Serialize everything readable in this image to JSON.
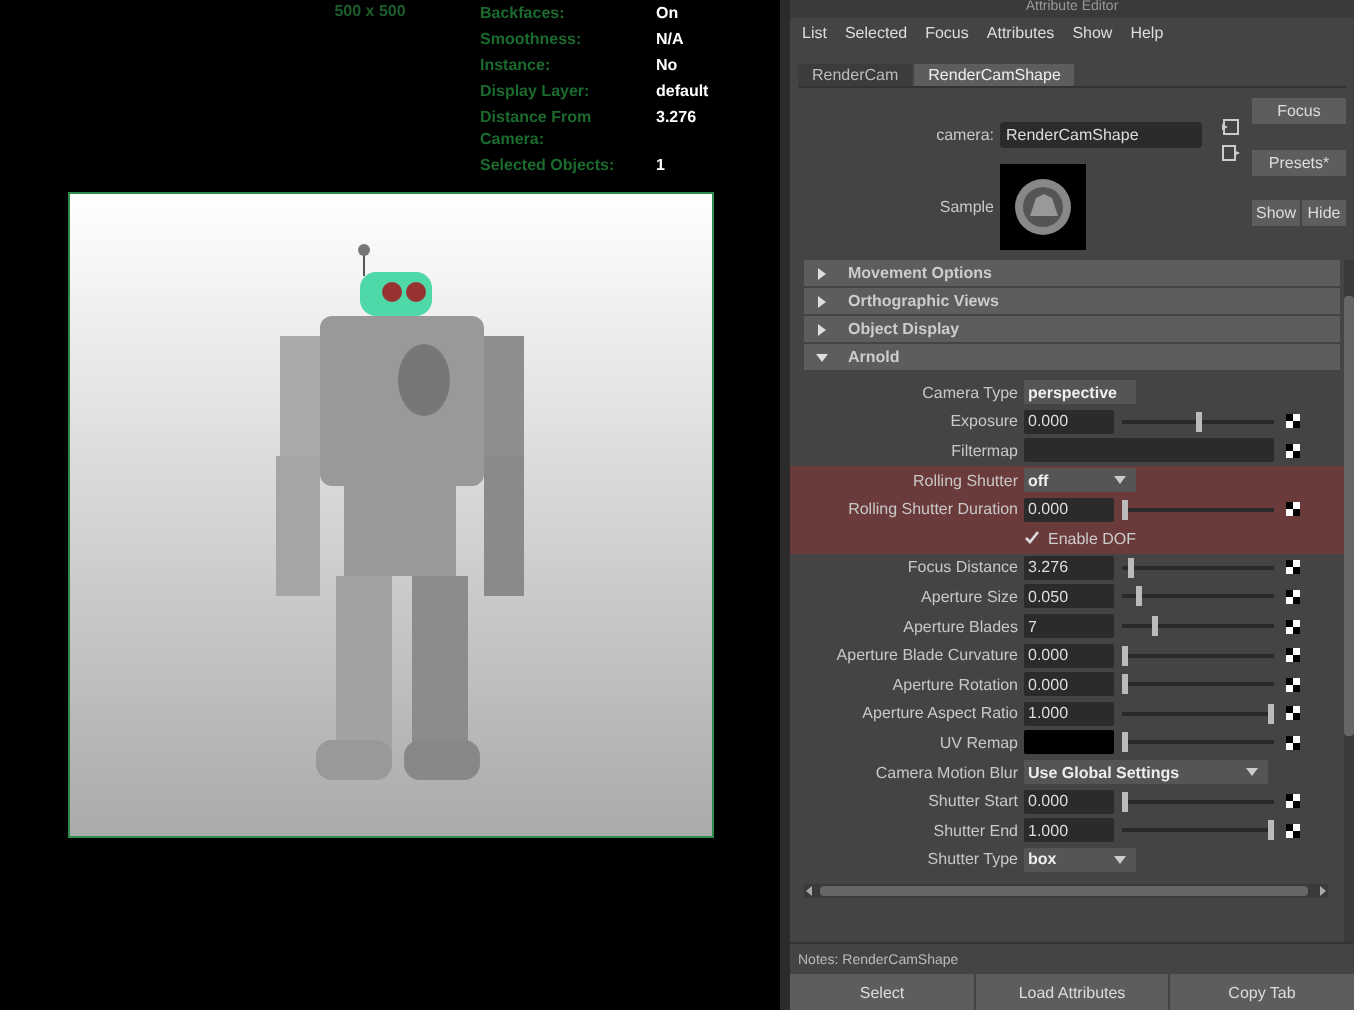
{
  "viewport": {
    "resolution": "500 x 500",
    "hud": [
      {
        "label": "Backfaces:",
        "value": "On"
      },
      {
        "label": "Smoothness:",
        "value": "N/A"
      },
      {
        "label": "Instance:",
        "value": "No"
      },
      {
        "label": "Display Layer:",
        "value": "default"
      },
      {
        "label": "Distance From Camera:",
        "value": "3.276"
      },
      {
        "label": "Selected Objects:",
        "value": "1"
      }
    ]
  },
  "editor": {
    "title": "Attribute Editor",
    "menu": [
      "List",
      "Selected",
      "Focus",
      "Attributes",
      "Show",
      "Help"
    ],
    "tabs": [
      {
        "label": "RenderCam",
        "selected": false
      },
      {
        "label": "RenderCamShape",
        "selected": true
      }
    ],
    "node_label": "camera:",
    "node_name": "RenderCamShape",
    "side_buttons": [
      "Focus",
      "Presets*",
      "Show",
      "Hide"
    ],
    "sample_label": "Sample",
    "sections": [
      {
        "title": "Movement Options",
        "expanded": false
      },
      {
        "title": "Orthographic Views",
        "expanded": false
      },
      {
        "title": "Object Display",
        "expanded": false
      },
      {
        "title": "Arnold",
        "expanded": true
      }
    ],
    "rows": [
      {
        "kind": "enum",
        "label": "Camera Type",
        "value": "perspective",
        "highlighted": false
      },
      {
        "kind": "slider",
        "label": "Exposure",
        "value": "0.000",
        "level": 0.5,
        "highlighted": false
      },
      {
        "kind": "text",
        "label": "Filtermap",
        "highlighted": false
      },
      {
        "kind": "enum",
        "label": "Rolling Shutter",
        "value": "off",
        "highlighted": true
      },
      {
        "kind": "slider",
        "label": "Rolling Shutter Duration",
        "value": "0.000",
        "level": 0,
        "highlighted": true
      },
      {
        "kind": "checkbox",
        "label": "Enable DOF",
        "checked": true,
        "highlighted": true
      },
      {
        "kind": "slider",
        "label": "Focus Distance",
        "value": "3.276",
        "level": 0.04,
        "highlighted": false
      },
      {
        "kind": "slider",
        "label": "Aperture Size",
        "value": "0.050",
        "level": 0.1,
        "highlighted": false
      },
      {
        "kind": "slider",
        "label": "Aperture Blades",
        "value": "7",
        "level": 0.2,
        "highlighted": false
      },
      {
        "kind": "slider",
        "label": "Aperture Blade Curvature",
        "value": "0.000",
        "level": 0,
        "highlighted": false
      },
      {
        "kind": "slider",
        "label": "Aperture Rotation",
        "value": "0.000",
        "level": 0,
        "highlighted": false
      },
      {
        "kind": "slider",
        "label": "Aperture Aspect Ratio",
        "value": "1.000",
        "level": 1,
        "highlighted": false
      },
      {
        "kind": "color",
        "label": "UV Remap",
        "level": 0,
        "highlighted": false
      },
      {
        "kind": "enum",
        "label": "Camera Motion Blur",
        "value": "Use Global Settings",
        "highlighted": false
      },
      {
        "kind": "slider",
        "label": "Shutter Start",
        "value": "0.000",
        "level": 0,
        "highlighted": false
      },
      {
        "kind": "slider",
        "label": "Shutter End",
        "value": "1.000",
        "level": 1,
        "highlighted": false
      },
      {
        "kind": "enum",
        "label": "Shutter Type",
        "value": "box",
        "highlighted": false
      }
    ],
    "notes": "Notes: RenderCamShape",
    "bottom_buttons": [
      "Select",
      "Load Attributes",
      "Copy Tab"
    ]
  }
}
